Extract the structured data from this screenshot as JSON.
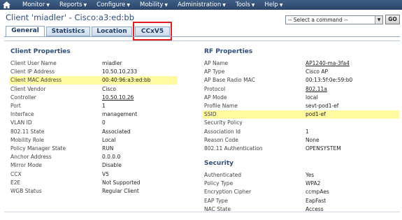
{
  "menubar": {
    "items": [
      {
        "label": "Monitor"
      },
      {
        "label": "Reports"
      },
      {
        "label": "Configure"
      },
      {
        "label": "Mobility"
      },
      {
        "label": "Administration"
      },
      {
        "label": "Tools"
      },
      {
        "label": "Help"
      }
    ]
  },
  "page": {
    "title": "Client 'miadler' - Cisco:a3:ed:bb",
    "command_select": "-- Select a command --",
    "go_label": "GO"
  },
  "tabs": [
    {
      "label": "General",
      "active": true
    },
    {
      "label": "Statistics",
      "active": false
    },
    {
      "label": "Location",
      "active": false
    },
    {
      "label": "CCxV5",
      "active": false
    }
  ],
  "client_properties": {
    "title": "Client Properties",
    "rows": [
      {
        "label": "Client User Name",
        "value": "miadler"
      },
      {
        "label": "Client IP Address",
        "value": "10.50.10.233"
      },
      {
        "label": "Client MAC Address",
        "value": "00:40:96:a3:ed:bb",
        "highlight": true
      },
      {
        "label": "Client Vendor",
        "value": "Cisco"
      },
      {
        "label": "Controller",
        "value": "10.50.10.26",
        "link": true
      },
      {
        "label": "Port",
        "value": "1"
      },
      {
        "label": "Interface",
        "value": "management"
      },
      {
        "label": "VLAN ID",
        "value": "0"
      },
      {
        "label": "802.11 State",
        "value": "Associated"
      },
      {
        "label": "Mobility Role",
        "value": "Local"
      },
      {
        "label": "Policy Manager State",
        "value": "RUN"
      },
      {
        "label": "Anchor Address",
        "value": "0.0.0.0"
      },
      {
        "label": "Mirror Mode",
        "value": "Disable"
      },
      {
        "label": "CCX",
        "value": "V5"
      },
      {
        "label": "E2E",
        "value": "Not Supported"
      },
      {
        "label": "WGB Status",
        "value": "Regular Client"
      }
    ]
  },
  "rf_properties": {
    "title": "RF Properties",
    "rows": [
      {
        "label": "AP Name",
        "value": "AP1240-ma-3fa4",
        "link": true
      },
      {
        "label": "AP Type",
        "value": "Cisco AP"
      },
      {
        "label": "AP Base Radio MAC",
        "value": "00:13:5f:0e:59:b0"
      },
      {
        "label": "Protocol",
        "value": "802.11a",
        "link": true
      },
      {
        "label": "AP Mode",
        "value": "local"
      },
      {
        "label": "Profile Name",
        "value": "sevt-pod1-ef"
      },
      {
        "label": "SSID",
        "value": "pod1-ef",
        "highlight": true
      },
      {
        "label": "Security Policy",
        "value": ""
      },
      {
        "label": "Association Id",
        "value": "1"
      },
      {
        "label": "Reason Code",
        "value": "None"
      },
      {
        "label": "802.11 Authentication",
        "value": "OPENSYSTEM"
      }
    ]
  },
  "security": {
    "title": "Security",
    "rows": [
      {
        "label": "Authenticated",
        "value": "Yes"
      },
      {
        "label": "Policy Type",
        "value": "WPA2"
      },
      {
        "label": "Encryption Cipher",
        "value": "ccmpAes"
      },
      {
        "label": "EAP Type",
        "value": "EapFast"
      },
      {
        "label": "NAC State",
        "value": "Access"
      }
    ]
  },
  "colors": {
    "menubar": "#2f4d75",
    "highlight": "#fffaa0",
    "tab_outline": "#dd1f1f",
    "title": "#2e4d7a"
  }
}
